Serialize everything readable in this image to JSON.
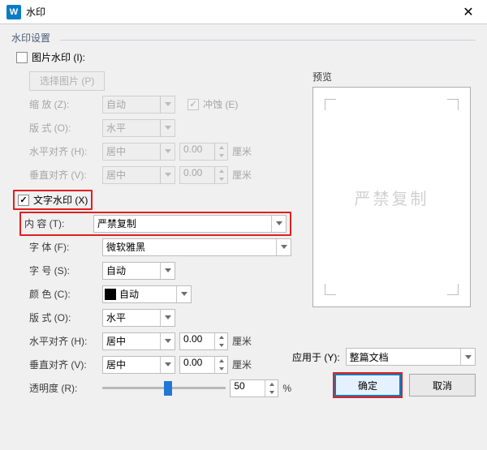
{
  "title": "水印",
  "app_icon_letter": "W",
  "group_label": "水印设置",
  "image_watermark": {
    "checked": false,
    "label": "图片水印 (I):",
    "select_btn": "选择图片 (P)",
    "scale_label": "缩   放 (Z):",
    "scale_value": "自动",
    "erosion_label": "冲蚀 (E)",
    "erosion_checked": true,
    "layout_label": "版    式 (O):",
    "layout_value": "水平",
    "halign_label": "水平对齐 (H):",
    "halign_value": "居中",
    "halign_num": "0.00",
    "valign_label": "垂直对齐 (V):",
    "valign_value": "居中",
    "valign_num": "0.00",
    "unit": "厘米"
  },
  "text_watermark": {
    "checked": true,
    "label": "文字水印 (X)",
    "content_label": "内    容 (T):",
    "content_value": "严禁复制",
    "font_label": "字    体 (F):",
    "font_value": "微软雅黑",
    "size_label": "字    号 (S):",
    "size_value": "自动",
    "color_label": "颜    色 (C):",
    "color_value": "自动",
    "layout_label": "版    式 (O):",
    "layout_value": "水平",
    "halign_label": "水平对齐 (H):",
    "halign_value": "居中",
    "halign_num": "0.00",
    "valign_label": "垂直对齐 (V):",
    "valign_value": "居中",
    "valign_num": "0.00",
    "unit": "厘米",
    "opacity_label": "透明度 (R):",
    "opacity_value": "50",
    "opacity_unit": "%"
  },
  "preview": {
    "label": "预览",
    "text": "严禁复制"
  },
  "apply": {
    "label": "应用于 (Y):",
    "value": "整篇文档"
  },
  "buttons": {
    "ok": "确定",
    "cancel": "取消"
  },
  "slider_percent": 50
}
